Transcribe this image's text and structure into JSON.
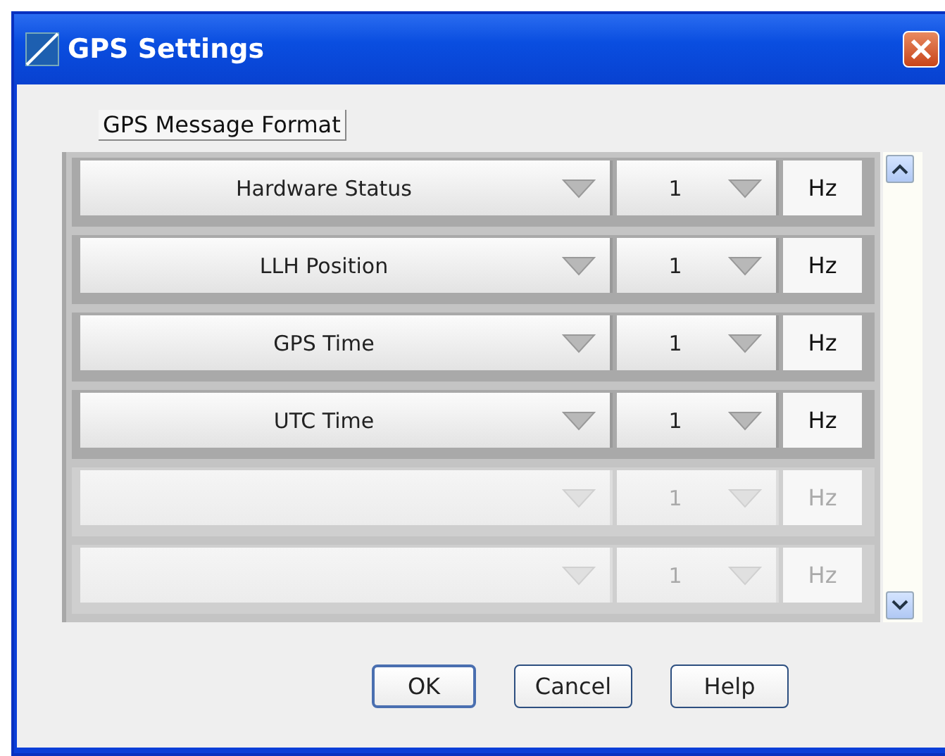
{
  "window": {
    "title": "GPS Settings"
  },
  "group": {
    "label": "GPS Message Format"
  },
  "rows": [
    {
      "message": "Hardware Status",
      "rate": "1",
      "unit": "Hz",
      "disabled": false
    },
    {
      "message": "LLH Position",
      "rate": "1",
      "unit": "Hz",
      "disabled": false
    },
    {
      "message": "GPS Time",
      "rate": "1",
      "unit": "Hz",
      "disabled": false
    },
    {
      "message": "UTC Time",
      "rate": "1",
      "unit": "Hz",
      "disabled": false
    },
    {
      "message": "",
      "rate": "1",
      "unit": "Hz",
      "disabled": true
    },
    {
      "message": "",
      "rate": "1",
      "unit": "Hz",
      "disabled": true
    }
  ],
  "buttons": [
    {
      "label": "OK",
      "default": true
    },
    {
      "label": "Cancel",
      "default": false
    },
    {
      "label": "Help",
      "default": false
    }
  ]
}
